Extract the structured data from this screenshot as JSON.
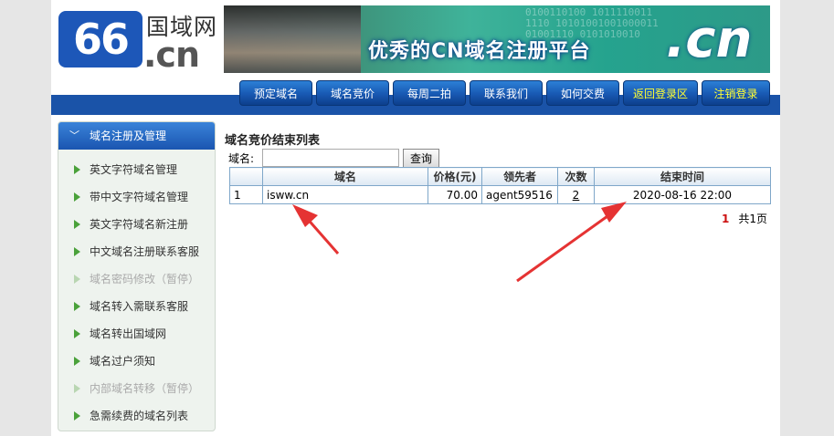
{
  "header": {
    "logo_number": "66",
    "logo_cn_name": "国域网",
    "logo_domain": ".cn",
    "banner_slogan": "优秀的CN域名注册平台",
    "banner_big_text": ".cn",
    "banner_binary": [
      "0100110100 1011110011",
      "1110 10101001001000011",
      "01001110 0101010010"
    ]
  },
  "nav": {
    "items": [
      {
        "label": "预定域名"
      },
      {
        "label": "域名竞价"
      },
      {
        "label": "每周二拍"
      },
      {
        "label": "联系我们"
      },
      {
        "label": "如何交费"
      },
      {
        "label": "返回登录区"
      },
      {
        "label": "注销登录"
      }
    ]
  },
  "sidebar": {
    "header": "域名注册及管理",
    "items": [
      {
        "label": "英文字符域名管理"
      },
      {
        "label": "带中文字符域名管理"
      },
      {
        "label": "英文字符域名新注册"
      },
      {
        "label": "中文域名注册联系客服"
      },
      {
        "label": "域名密码修改（暂停）"
      },
      {
        "label": "域名转入需联系客服"
      },
      {
        "label": "域名转出国域网"
      },
      {
        "label": "域名过户须知"
      },
      {
        "label": "内部域名转移（暂停）"
      },
      {
        "label": "急需续费的域名列表"
      }
    ]
  },
  "main": {
    "title": "域名竞价结束列表",
    "search": {
      "label": "域名:",
      "value": "",
      "button": "查询"
    },
    "table": {
      "headers": [
        "",
        "域名",
        "价格(元)",
        "领先者",
        "次数",
        "结束时间"
      ],
      "rows": [
        {
          "index": "1",
          "domain": "isww.cn",
          "price": "70.00",
          "leader": "agent59516",
          "bids": "2",
          "end_time": "2020-08-16 22:00"
        }
      ]
    },
    "pager": {
      "current": "1",
      "total": "共1页"
    }
  },
  "colors": {
    "nav_blue": "#1a53a8",
    "arrow_red": "#e53333",
    "sidebar_bg": "#eef3ee",
    "table_border": "#7fa7c9"
  }
}
